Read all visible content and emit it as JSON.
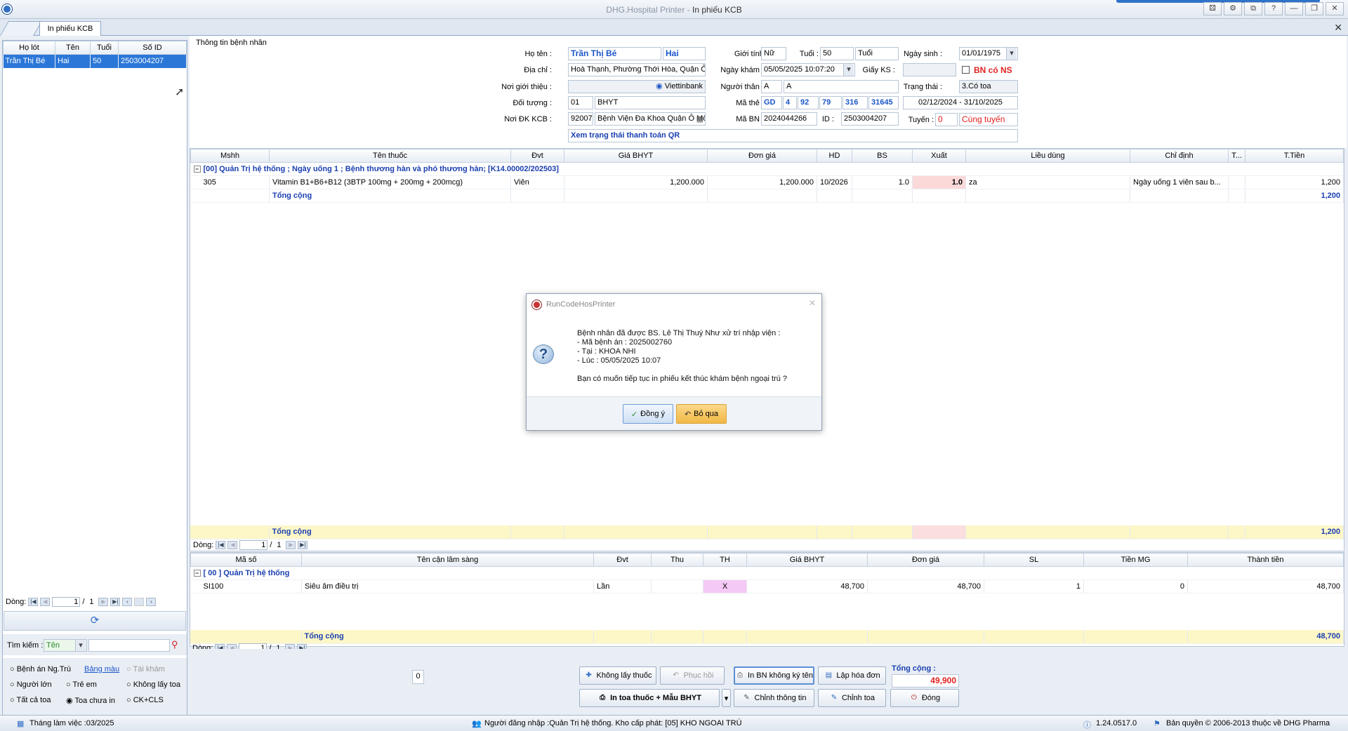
{
  "window": {
    "title_app": "DHG.Hospital Printer",
    "title_sep": " - ",
    "title_doc": "In phiếu KCB",
    "buttons": [
      "⚄",
      "⚙",
      "⧉",
      "?",
      "—",
      "❐",
      "✕"
    ]
  },
  "tab": {
    "label": "In phiếu KCB",
    "close": "✕"
  },
  "left": {
    "headers": [
      "Họ lót",
      "Tên",
      "Tuổi",
      "Số ID"
    ],
    "row": {
      "ho_lot": "Trần Thị Bé",
      "ten": "Hai",
      "tuoi": "50",
      "so_id": "2503004207"
    },
    "nav": {
      "label": "Dòng:",
      "page": "1",
      "sep": "/",
      "total": "1"
    },
    "search": {
      "label": "Tìm kiếm :",
      "mode": "Tên",
      "value": ""
    },
    "options": {
      "benh_an": "Bệnh án Ng.Trú",
      "bang_mau": "Bảng màu",
      "tai_kham": "Tái khám",
      "nguoi_lon": "Người lớn",
      "tre_em": "Trẻ em",
      "khong_lay_toa": "Không lấy toa",
      "tat_ca_toa": "Tất cả toa",
      "toa_chua_in": "Toa chưa in",
      "ck_cls": "CK+CLS"
    }
  },
  "info": {
    "section": "Thông tin bệnh nhân",
    "ho_ten_lbl": "Họ tên :",
    "ho_lot": "Trần Thị Bé",
    "ten": "Hai",
    "gioi_tinh_lbl": "Giới tính :",
    "gioi_tinh": "Nữ",
    "tuoi_lbl": "Tuổi :",
    "tuoi": "50",
    "tuoi_unit": "Tuổi",
    "ngay_sinh_lbl": "Ngày sinh :",
    "ngay_sinh": "01/01/1975",
    "dia_chi_lbl": "Địa chỉ :",
    "dia_chi": "Hoà Thạnh, Phường Thới Hòa, Quận Ô Môn",
    "ngay_kham_lbl": "Ngày khám :",
    "ngay_kham": "05/05/2025 10:07:20",
    "giay_ks_lbl": "Giấy KS :",
    "giay_ks": "",
    "bn_co_ns": "BN có NS",
    "noi_gioi_thieu_lbl": "Nơi giới thiệu :",
    "bank": "Viettinbank",
    "nguoi_than_lbl": "Người thân :",
    "nguoi_than_1": "A",
    "nguoi_than_2": "A",
    "trang_thai_lbl": "Trạng thái :",
    "trang_thai": "3.Có toa",
    "doi_tuong_lbl": "Đối tượng :",
    "doi_tuong_ma": "01",
    "doi_tuong": "BHYT",
    "ma_the_lbl": "Mã thẻ :",
    "ma_the": [
      "GD",
      "4",
      "92",
      "79",
      "316",
      "31645"
    ],
    "han_the": "02/12/2024 - 31/10/2025",
    "noi_dk_lbl": "Nơi ĐK KCB :",
    "noi_dk_ma": "92007",
    "noi_dk": "Bệnh Viện Đa Khoa Quận Ô Môn",
    "ma_bn_lbl": "Mã BN :",
    "ma_bn": "2024044266",
    "id_lbl": "ID :",
    "id": "2503004207",
    "tuyen_lbl": "Tuyến :",
    "tuyen_ma": "0",
    "tuyen": "Cùng tuyến",
    "qr_link": "Xem trạng thái thanh toán QR"
  },
  "drug": {
    "headers": [
      "Mshh",
      "Tên thuốc",
      "Đvt",
      "Giá BHYT",
      "Đơn giá",
      "HD",
      "BS",
      "Xuất",
      "Liều dùng",
      "Chỉ định",
      "T...",
      "T.Tiền"
    ],
    "group": "[00] Quản Trị hệ thống ; Ngày uống 1 ; Bệnh thương hàn và phó thương hàn; [K14.00002/202503]",
    "rows": [
      {
        "mshh": "305",
        "ten": "Vitamin B1+B6+B12 (3BTP 100mg + 200mg + 200mcg)",
        "dvt": "Viên",
        "gia_bhyt": "1,200.000",
        "don_gia": "1,200.000",
        "hd": "10/2026",
        "bs": "1.0",
        "xuat": "1.0",
        "lieu": "za",
        "chi_dinh": "Ngày uống  1 viên sau b...",
        "t": "",
        "tien": "1,200"
      }
    ],
    "total_label": "Tổng cộng",
    "total": "1,200",
    "nav": {
      "label": "Dòng:",
      "page": "1",
      "sep": "/",
      "total": "1"
    }
  },
  "cls": {
    "headers": [
      "Mã số",
      "Tên cận lâm sàng",
      "Đvt",
      "Thu",
      "TH",
      "Giá BHYT",
      "Đơn giá",
      "SL",
      "Tiền MG",
      "Thành tiền"
    ],
    "group": "[ 00 ] Quản Trị hệ thống",
    "rows": [
      {
        "ma": "SI100",
        "ten": "Siêu âm điều trị",
        "dvt": "Lần",
        "thu": "",
        "th": "X",
        "gia_bhyt": "48,700",
        "don_gia": "48,700",
        "sl": "1",
        "tien_mg": "0",
        "thanh_tien": "48,700"
      }
    ],
    "total_label": "Tổng cộng",
    "total": "48,700",
    "nav": {
      "label": "Dòng:",
      "page": "1",
      "sep": "/",
      "total": "1"
    }
  },
  "actions": {
    "counter": "0",
    "khong_lay_thuoc": "Không lấy thuốc",
    "phuc_hoi": "Phục hồi",
    "in_bn": "In BN không ký tên",
    "lap_hoa_don": "Lập hóa đơn",
    "in_toa": "In toa thuốc + Mẫu BHYT",
    "chinh_thong_tin": "Chỉnh thông tin",
    "chinh_toa": "Chỉnh toa",
    "dong": "Đóng",
    "tong_cong_lbl": "Tổng cộng :",
    "tong_cong": "49,900"
  },
  "status": {
    "thang": "Tháng làm việc :03/2025",
    "nguoi_dang_nhap": "Người đăng nhập :Quản Trị hệ thống. Kho cấp phát: [05] KHO NGOAI TRÚ",
    "version": "1.24.0517.0",
    "copyright": "Bản quyền © 2006-2013 thuộc về DHG Pharma"
  },
  "dialog": {
    "title": "RunCodeHosPrinter",
    "line1": "Bệnh nhân đã được BS. Lê Thị Thuý Như xử trí nhập viện :",
    "line2": " - Mã bệnh án : 2025002760",
    "line3": " - Tại : KHOA NHI",
    "line4": " - Lúc : 05/05/2025 10:07",
    "question": "Bạn có muốn tiếp tục in phiếu kết thúc khám bệnh ngoại trú ?",
    "ok": "Đồng ý",
    "cancel": "Bỏ qua"
  }
}
